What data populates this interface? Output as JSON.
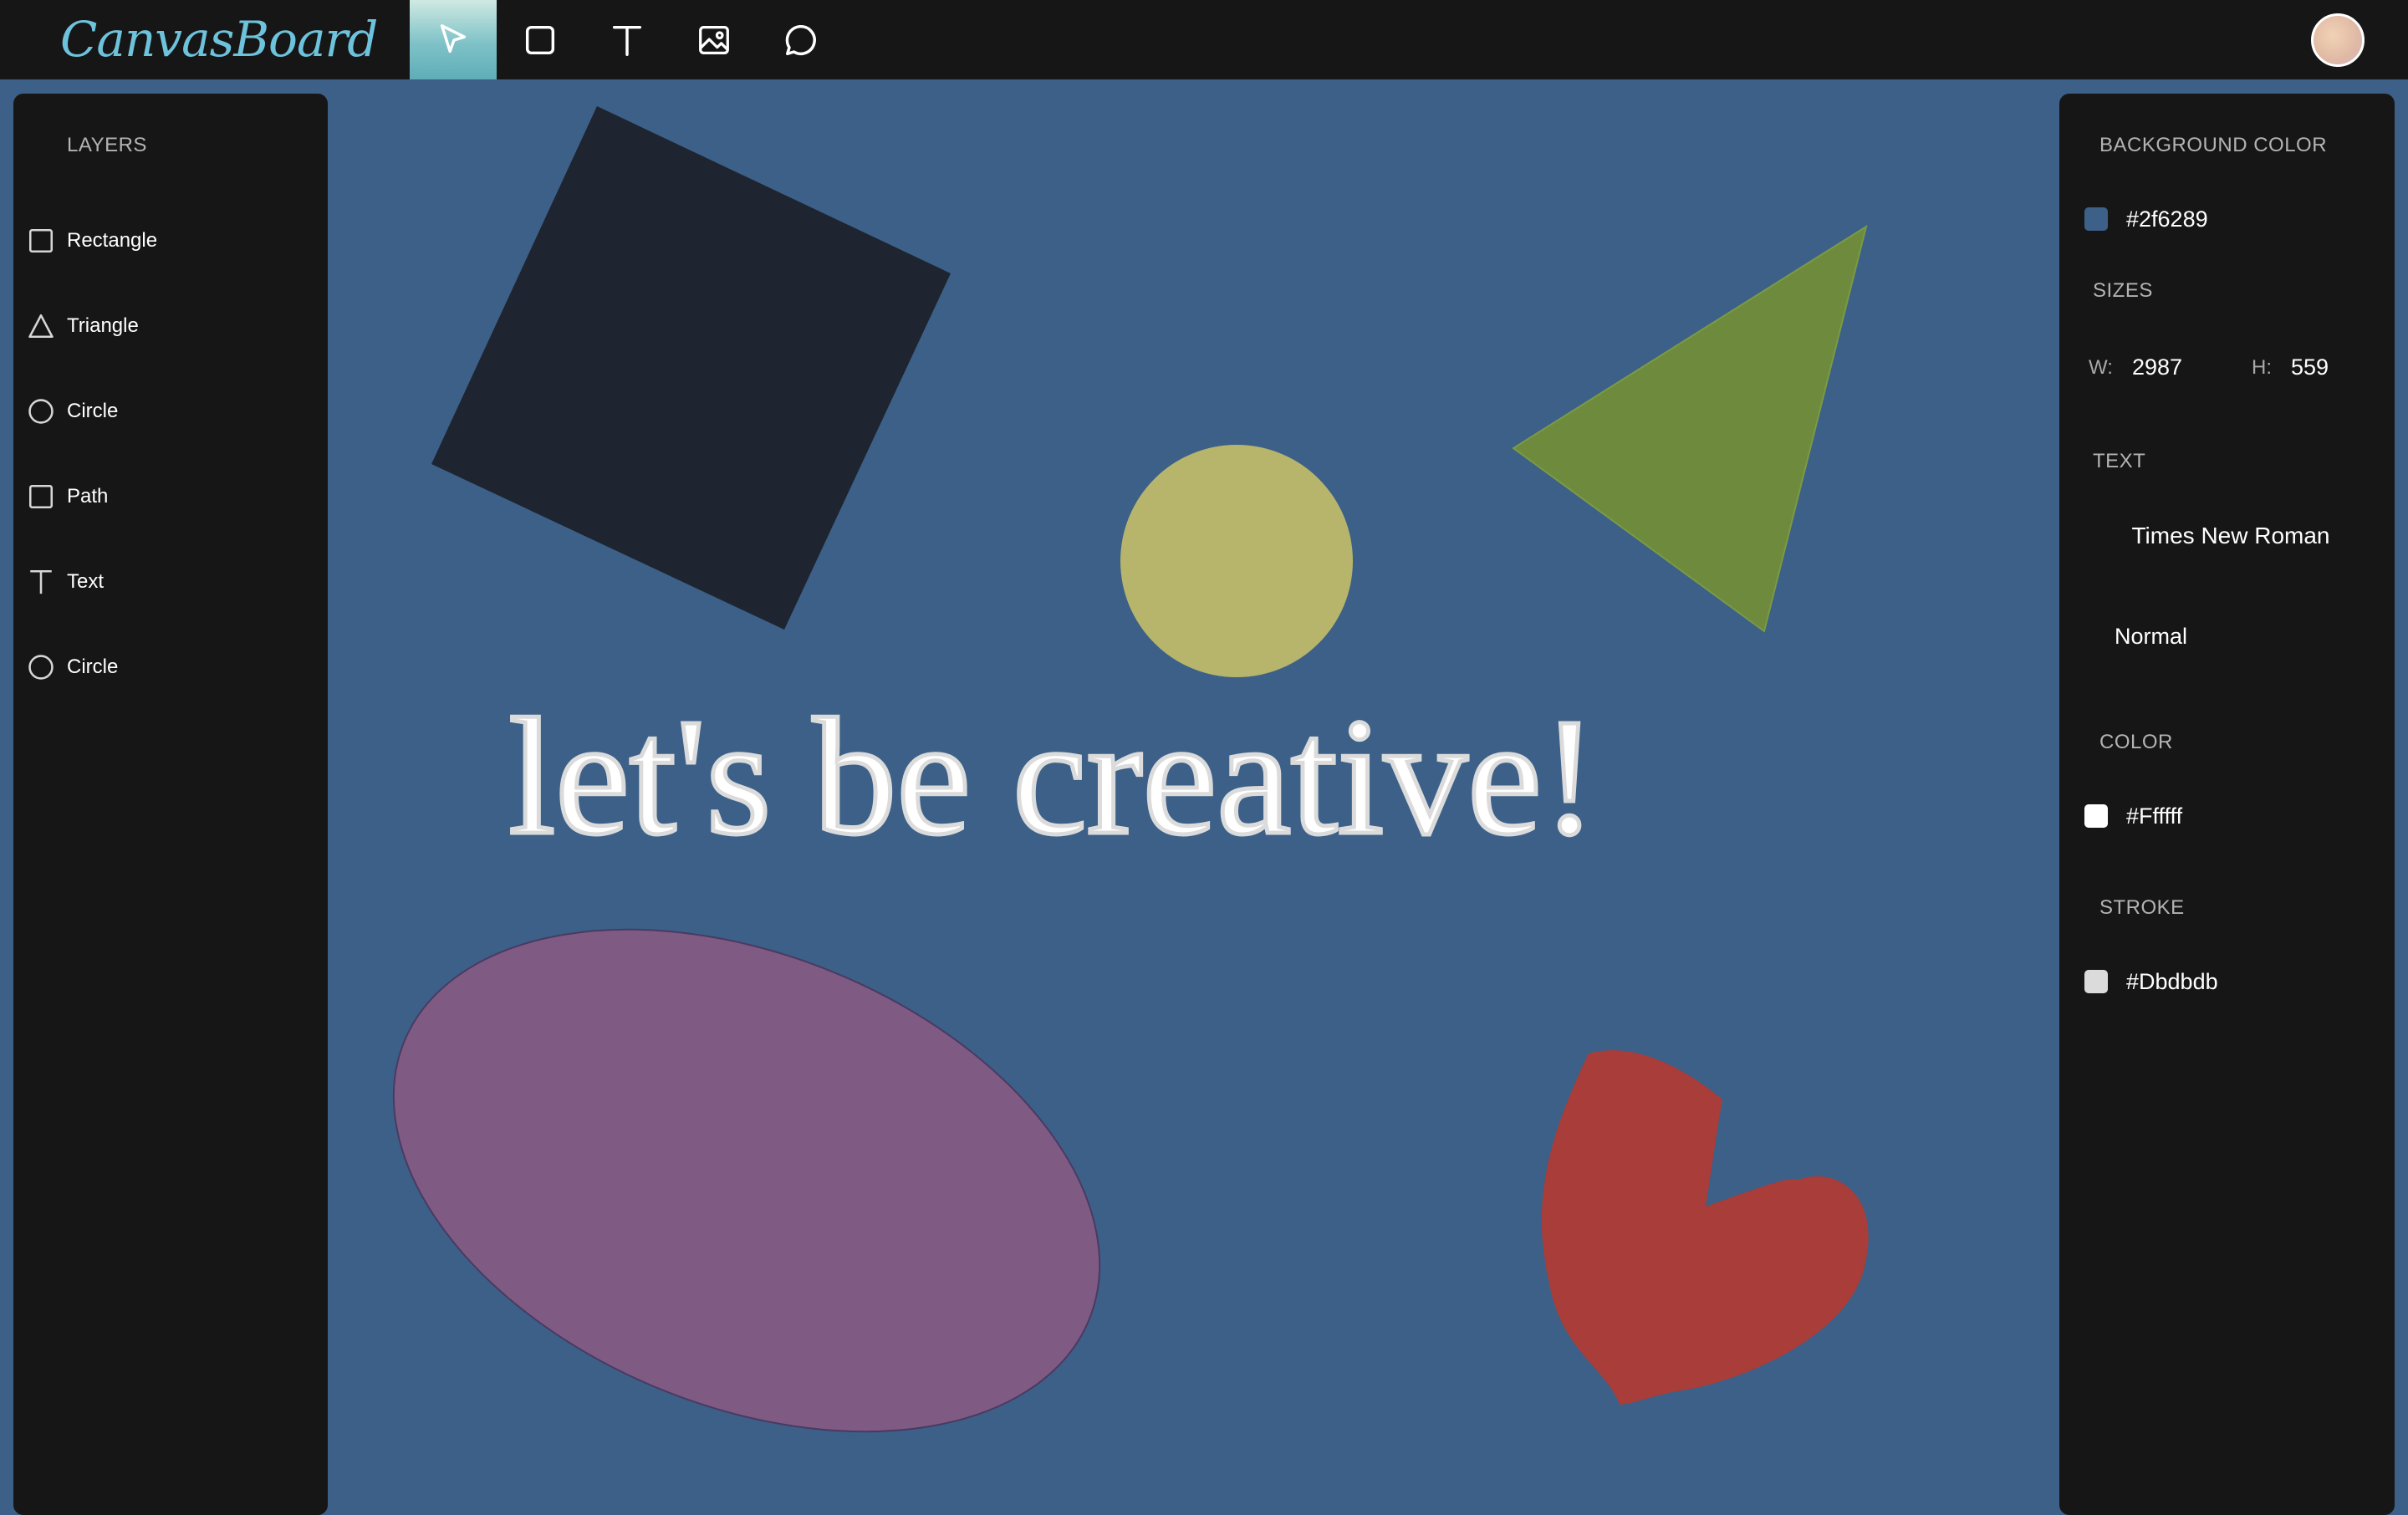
{
  "app": {
    "logo": "CanvasBoard"
  },
  "toolbar": {
    "tools": [
      {
        "name": "select",
        "icon": "cursor-icon",
        "active": true
      },
      {
        "name": "rectangle",
        "icon": "square-icon",
        "active": false
      },
      {
        "name": "text",
        "icon": "text-icon",
        "active": false
      },
      {
        "name": "image",
        "icon": "image-icon",
        "active": false
      },
      {
        "name": "comment",
        "icon": "chat-bubble-icon",
        "active": false
      }
    ]
  },
  "layers": {
    "title": "LAYERS",
    "items": [
      {
        "label": "Rectangle",
        "icon": "square-icon"
      },
      {
        "label": "Triangle",
        "icon": "triangle-icon"
      },
      {
        "label": "Circle",
        "icon": "circle-icon"
      },
      {
        "label": "Path",
        "icon": "square-icon"
      },
      {
        "label": "Text",
        "icon": "text-icon"
      },
      {
        "label": "Circle",
        "icon": "circle-icon"
      }
    ]
  },
  "properties": {
    "background_title": "BACKGROUND COLOR",
    "background_value": "#2f6289",
    "background_swatch": "#3c6087",
    "sizes_title": "SIZES",
    "width_label": "W:",
    "width_value": "2987",
    "height_label": "H:",
    "height_value": "559",
    "text_title": "TEXT",
    "font_family": "Times New Roman",
    "font_weight": "Normal",
    "color_title": "COLOR",
    "color_value": "#Ffffff",
    "color_swatch": "#ffffff",
    "stroke_title": "STROKE",
    "stroke_value": "#Dbdbdb",
    "stroke_swatch": "#dbdbdb"
  },
  "canvas": {
    "text": "let's be creative!",
    "colors": {
      "rectangle": "#1e2430",
      "triangle": "#6e8b3d",
      "circle": "#b7b46c",
      "ellipse": "#7f5b84",
      "heart": "#a83d3a"
    }
  }
}
